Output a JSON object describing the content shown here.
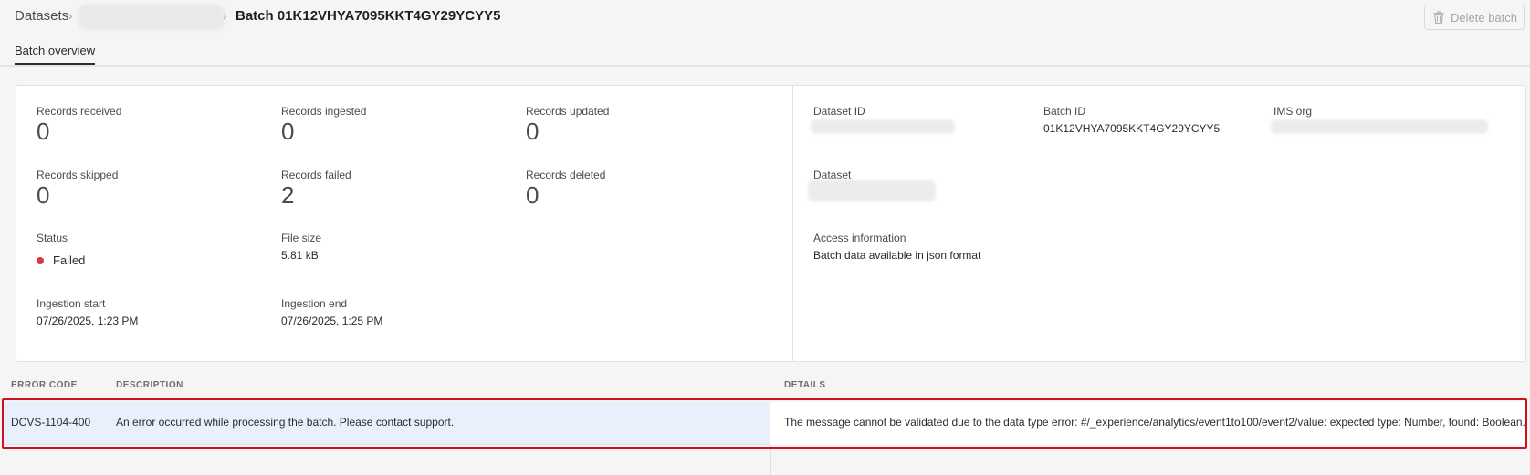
{
  "breadcrumb": {
    "root": "Datasets",
    "separator": "›",
    "current": "Batch 01K12VHYA7095KKT4GY29YCYY5"
  },
  "toolbar": {
    "delete_label": "Delete batch",
    "delete_icon": "trash-icon"
  },
  "tabs": [
    {
      "label": "Batch overview",
      "active": true
    }
  ],
  "overview": {
    "records_received": {
      "label": "Records received",
      "value": "0"
    },
    "records_ingested": {
      "label": "Records ingested",
      "value": "0"
    },
    "records_updated": {
      "label": "Records updated",
      "value": "0"
    },
    "records_skipped": {
      "label": "Records skipped",
      "value": "0"
    },
    "records_failed": {
      "label": "Records failed",
      "value": "2"
    },
    "records_deleted": {
      "label": "Records deleted",
      "value": "0"
    },
    "status": {
      "label": "Status",
      "value": "Failed",
      "color": "#d7373f"
    },
    "file_size": {
      "label": "File size",
      "value": "5.81 kB"
    },
    "ingestion_start": {
      "label": "Ingestion start",
      "value": "07/26/2025, 1:23 PM"
    },
    "ingestion_end": {
      "label": "Ingestion end",
      "value": "07/26/2025, 1:25 PM"
    }
  },
  "details": {
    "dataset_id": {
      "label": "Dataset ID"
    },
    "batch_id": {
      "label": "Batch ID",
      "value": "01K12VHYA7095KKT4GY29YCYY5"
    },
    "ims_org": {
      "label": "IMS org"
    },
    "dataset": {
      "label": "Dataset"
    },
    "access_information": {
      "label": "Access information",
      "value": "Batch data available in json format"
    }
  },
  "errors_table": {
    "columns": [
      "ERROR CODE",
      "DESCRIPTION",
      "DETAILS"
    ],
    "rows": [
      {
        "error_code": "DCVS-1104-400",
        "description": "An error occurred while processing the batch. Please contact support.",
        "details": "The message cannot be validated due to the data type error: #/_experience/analytics/event1to100/event2/value: expected type: Number, found: Boolean."
      }
    ],
    "highlight_color": "#d0101c"
  }
}
